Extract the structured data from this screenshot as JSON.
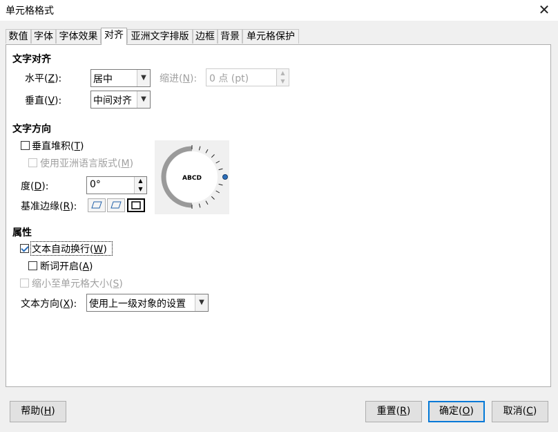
{
  "window": {
    "title": "单元格格式",
    "close": "✕"
  },
  "tabs": [
    "数值",
    "字体",
    "字体效果",
    "对齐",
    "亚洲文字排版",
    "边框",
    "背景",
    "单元格保护"
  ],
  "alignment": {
    "section_title": "文字对齐",
    "horizontal_label_prefix": "水平(",
    "horizontal_key": "Z",
    "horizontal_label_suffix": "):",
    "horizontal_value": "居中",
    "indent_label_prefix": "缩进(",
    "indent_key": "N",
    "indent_label_suffix": "):",
    "indent_value": "0 点 (pt)",
    "vertical_label_prefix": "垂直(",
    "vertical_key": "V",
    "vertical_label_suffix": "):",
    "vertical_value": "中间对齐"
  },
  "orientation": {
    "section_title": "文字方向",
    "stacked_prefix": "垂直堆积(",
    "stacked_key": "T",
    "stacked_suffix": ")",
    "asian_prefix": "使用亚洲语言版式(",
    "asian_key": "M",
    "asian_suffix": ")",
    "degrees_prefix": "度(",
    "degrees_key": "D",
    "degrees_suffix": "):",
    "degrees_value": "0°",
    "edge_prefix": "基准边缘(",
    "edge_key": "R",
    "edge_suffix": "):",
    "dial_text": "ABCD"
  },
  "properties": {
    "section_title": "属性",
    "wrap_prefix": "文本自动换行(",
    "wrap_key": "W",
    "wrap_suffix": ")",
    "wrap_checked": true,
    "hyphen_prefix": "断词开启(",
    "hyphen_key": "A",
    "hyphen_suffix": ")",
    "shrink_prefix": "缩小至单元格大小(",
    "shrink_key": "S",
    "shrink_suffix": ")",
    "direction_prefix": "文本方向(",
    "direction_key": "X",
    "direction_suffix": "):",
    "direction_value": "使用上一级对象的设置"
  },
  "buttons": {
    "help_prefix": "帮助(",
    "help_key": "H",
    "help_suffix": ")",
    "reset_prefix": "重置(",
    "reset_key": "R",
    "reset_suffix": ")",
    "ok_prefix": "确定(",
    "ok_key": "O",
    "ok_suffix": ")",
    "cancel_prefix": "取消(",
    "cancel_key": "C",
    "cancel_suffix": ")"
  }
}
